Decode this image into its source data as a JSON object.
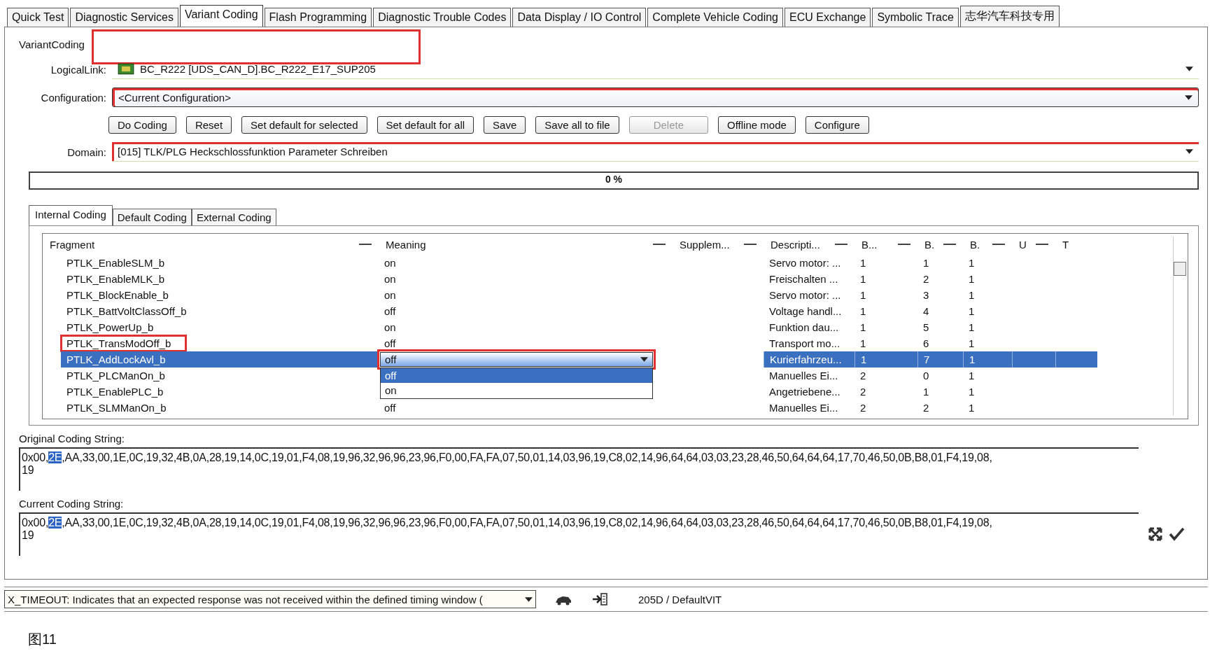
{
  "tabs": [
    {
      "label": "Quick Test",
      "selected": false
    },
    {
      "label": "Diagnostic Services",
      "selected": false
    },
    {
      "label": "Variant Coding",
      "selected": true
    },
    {
      "label": "Flash Programming",
      "selected": false
    },
    {
      "label": "Diagnostic Trouble Codes",
      "selected": false
    },
    {
      "label": "Data Display / IO Control",
      "selected": false
    },
    {
      "label": "Complete Vehicle Coding",
      "selected": false
    },
    {
      "label": "ECU Exchange",
      "selected": false
    },
    {
      "label": "Symbolic Trace",
      "selected": false
    },
    {
      "label": "志华汽车科技专用",
      "selected": false
    }
  ],
  "variant_coding": {
    "title": "VariantCoding",
    "highlighted": true,
    "logical_link": {
      "label": "LogicalLink:",
      "value": "BC_R222 [UDS_CAN_D].BC_R222_E17_SUP205"
    },
    "configuration": {
      "label": "Configuration:",
      "value": "<Current Configuration>",
      "highlighted": true
    },
    "buttons": [
      {
        "label": "Do Coding",
        "disabled": false
      },
      {
        "label": "Reset",
        "disabled": false
      },
      {
        "label": "Set default for selected",
        "disabled": false
      },
      {
        "label": "Set default for all",
        "disabled": false
      },
      {
        "label": "Save",
        "disabled": false
      },
      {
        "label": "Save all to file",
        "disabled": false
      },
      {
        "label": "Delete",
        "disabled": true
      },
      {
        "label": "Offline mode",
        "disabled": false
      },
      {
        "label": "Configure",
        "disabled": false
      }
    ],
    "domain": {
      "label": "Domain:",
      "value": "[015] TLK/PLG Heckschlossfunktion Parameter Schreiben",
      "highlighted": true
    },
    "progress": {
      "level": 0,
      "reading": "0 %"
    }
  },
  "sub_tabs": [
    {
      "label": "Internal Coding",
      "selected": true
    },
    {
      "label": "Default Coding",
      "selected": false
    },
    {
      "label": "External Coding",
      "selected": false
    }
  ],
  "table": {
    "columns": [
      "Fragment",
      "Meaning",
      "Supplem...",
      "Descripti...",
      "B...",
      "B.",
      "B.",
      "U",
      "T"
    ],
    "rows": [
      {
        "fragment": "PTLK_EnableSLM_b",
        "meaning": "on",
        "description": "Servo motor: ...",
        "b1": "1",
        "b2": "1",
        "b3": "1",
        "selected": false,
        "highlighted": false
      },
      {
        "fragment": "PTLK_EnableMLK_b",
        "meaning": "on",
        "description": "Freischalten ...",
        "b1": "1",
        "b2": "2",
        "b3": "1",
        "selected": false,
        "highlighted": false
      },
      {
        "fragment": "PTLK_BlockEnable_b",
        "meaning": "on",
        "description": "Servo motor: ...",
        "b1": "1",
        "b2": "3",
        "b3": "1",
        "selected": false,
        "highlighted": false
      },
      {
        "fragment": "PTLK_BattVoltClassOff_b",
        "meaning": "off",
        "description": "Voltage handl...",
        "b1": "1",
        "b2": "4",
        "b3": "1",
        "selected": false,
        "highlighted": false
      },
      {
        "fragment": "PTLK_PowerUp_b",
        "meaning": "on",
        "description": "Funktion dau...",
        "b1": "1",
        "b2": "5",
        "b3": "1",
        "selected": false,
        "highlighted": false
      },
      {
        "fragment": "PTLK_TransModOff_b",
        "meaning": "off",
        "description": "Transport mo...",
        "b1": "1",
        "b2": "6",
        "b3": "1",
        "selected": false,
        "highlighted": true
      },
      {
        "fragment": "PTLK_AddLockAvl_b",
        "description": "Kurierfahrzeu...",
        "b1": "1",
        "b2": "7",
        "b3": "1",
        "selected": true,
        "highlighted": false,
        "dropdown": {
          "value": "off",
          "highlighted": true,
          "options": [
            {
              "label": "off",
              "selected": true
            },
            {
              "label": "on",
              "selected": false
            }
          ]
        }
      },
      {
        "fragment": "PTLK_PLCManOn_b",
        "description": "Manuelles Ei...",
        "b1": "2",
        "b2": "0",
        "b3": "1",
        "selected": false,
        "highlighted": false
      },
      {
        "fragment": "PTLK_EnablePLC_b",
        "description": "Angetriebene...",
        "b1": "2",
        "b2": "1",
        "b3": "1",
        "selected": false,
        "highlighted": false
      },
      {
        "fragment": "PTLK_SLMManOn_b",
        "meaning": "off",
        "description": "Manuelles Ei...",
        "b1": "2",
        "b2": "2",
        "b3": "1",
        "selected": false,
        "highlighted": false
      }
    ]
  },
  "original_coding": {
    "label": "Original Coding String:",
    "before": "0x00,",
    "selection": "2E",
    "after": ",AA,33,00,1E,0C,19,32,4B,0A,28,19,14,0C,19,01,F4,08,19,96,32,96,96,23,96,F0,00,FA,FA,07,50,01,14,03,96,19,C8,02,14,96,64,64,03,03,23,28,46,50,64,64,64,17,70,46,50,0B,B8,01,F4,19,08,",
    "line_2": "19"
  },
  "current_coding": {
    "label": "Current Coding String:",
    "before": "0x00,",
    "selection": "2E",
    "after": ",AA,33,00,1E,0C,19,32,4B,0A,28,19,14,0C,19,01,F4,08,19,96,32,96,96,23,96,F0,00,FA,FA,07,50,01,14,03,96,19,C8,02,14,96,64,64,03,03,23,28,46,50,64,64,64,17,70,46,50,0B,B8,01,F4,19,08,",
    "line_2": "19"
  },
  "status_bar": {
    "message": "X_TIMEOUT: Indicates that an expected response was not received within the defined timing window (",
    "vehicle": "205D / DefaultVIT"
  },
  "caption": "图11"
}
